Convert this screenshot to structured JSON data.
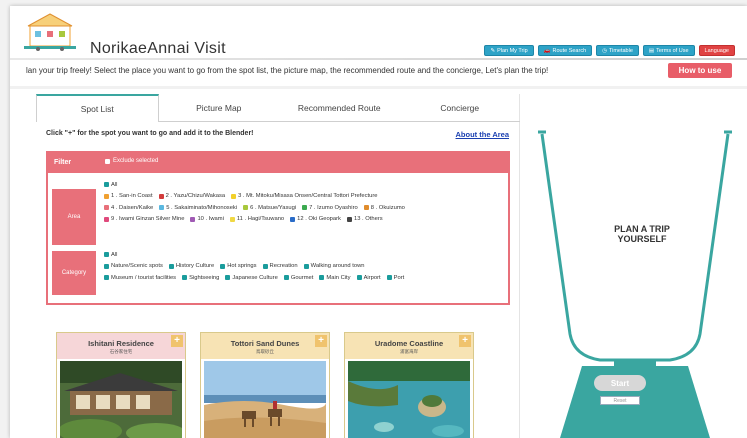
{
  "header": {
    "site_title": "NorikaeAnnai Visit",
    "nav": [
      {
        "label": "Plan My Trip",
        "icon": "pencil-icon"
      },
      {
        "label": "Route Search",
        "icon": "car-icon"
      },
      {
        "label": "Timetable",
        "icon": "clock-icon"
      },
      {
        "label": "Terms of Use",
        "icon": "document-icon"
      },
      {
        "label": "Language",
        "icon": ""
      }
    ]
  },
  "intro": {
    "tagline": "lan your trip freely! Select the place you want to go from the spot list, the picture map, the recommended route and the concierge, Let's plan the trip!",
    "how_to": "How to use"
  },
  "tabs": [
    {
      "label": "Spot List",
      "active": true
    },
    {
      "label": "Picture Map",
      "active": false
    },
    {
      "label": "Recommended Route",
      "active": false
    },
    {
      "label": "Concierge",
      "active": false
    }
  ],
  "instruction": "Click \"+\" for the spot you want to go and add it to the Blender!",
  "about_link": "About the Area",
  "filter": {
    "title": "Filter",
    "exclude_label": "Exclude selected",
    "area_label": "Area",
    "category_label": "Category",
    "area_rows": [
      [
        {
          "label": "All",
          "color": "#1a9c9c"
        }
      ],
      [
        {
          "label": "1 . San-in Coast",
          "color": "#f0a030"
        },
        {
          "label": "2 . Yazu/Chizu/Wakasa",
          "color": "#d23c3c"
        },
        {
          "label": "3 . Mt. Mitoku/Misasa Onsen/Central Tottori Prefecture",
          "color": "#f2d02a"
        }
      ],
      [
        {
          "label": "4 . Daisen/Kaike",
          "color": "#e8707a"
        },
        {
          "label": "5 . Sakaiminato/Mihonoseki",
          "color": "#5ab8e0"
        },
        {
          "label": "6 . Matsue/Yasugi",
          "color": "#a8c83c"
        },
        {
          "label": "7 . Izumo Oyashiro",
          "color": "#3caa50"
        },
        {
          "label": "8 . Okuizumo",
          "color": "#e08c2c"
        }
      ],
      [
        {
          "label": "9 . Iwami Ginzan Silver Mine",
          "color": "#e04a7c"
        },
        {
          "label": "10 . Iwami",
          "color": "#a05ab4"
        },
        {
          "label": "11 . Hagi/Tsuwano",
          "color": "#f0d844"
        },
        {
          "label": "12 . Oki Geopark",
          "color": "#2a6cc8"
        },
        {
          "label": "13 . Others",
          "color": "#444444"
        }
      ]
    ],
    "category_rows": [
      [
        {
          "label": "All",
          "color": "#1a9c9c"
        }
      ],
      [
        {
          "label": "Nature/Scenic spots",
          "color": "#1a9c9c"
        },
        {
          "label": "History Culture",
          "color": "#1a9c9c"
        },
        {
          "label": "Hot springs",
          "color": "#1a9c9c"
        },
        {
          "label": "Recreation",
          "color": "#1a9c9c"
        },
        {
          "label": "Walking around town",
          "color": "#1a9c9c"
        }
      ],
      [
        {
          "label": "Museum / tourist facilities",
          "color": "#1a9c9c"
        },
        {
          "label": "Sightseeing",
          "color": "#1a9c9c"
        },
        {
          "label": "Japanese Culture",
          "color": "#1a9c9c"
        },
        {
          "label": "Gourmet",
          "color": "#1a9c9c"
        },
        {
          "label": "Main City",
          "color": "#1a9c9c"
        },
        {
          "label": "Airport",
          "color": "#1a9c9c"
        },
        {
          "label": "Port",
          "color": "#1a9c9c"
        }
      ]
    ]
  },
  "cards": [
    {
      "title": "Ishitani Residence",
      "subtitle": "石谷家住宅",
      "bg": "#f6d6d8",
      "image": "japanese-house-garden"
    },
    {
      "title": "Tottori Sand Dunes",
      "subtitle": "鳥取砂丘",
      "bg": "#f7e3b4",
      "image": "sand-dunes-camels"
    },
    {
      "title": "Uradome Coastline",
      "subtitle": "浦富海岸",
      "bg": "#f7e3b4",
      "image": "rocky-coastline"
    }
  ],
  "blender": {
    "text_line1": "PLAN A TRIP",
    "text_line2": "YOURSELF",
    "start": "Start",
    "reset": "Reset"
  },
  "colors": {
    "accent": "#e8707a",
    "teal": "#3aa6a0",
    "nav_blue": "#2ea3c7",
    "language_red": "#e04343"
  }
}
